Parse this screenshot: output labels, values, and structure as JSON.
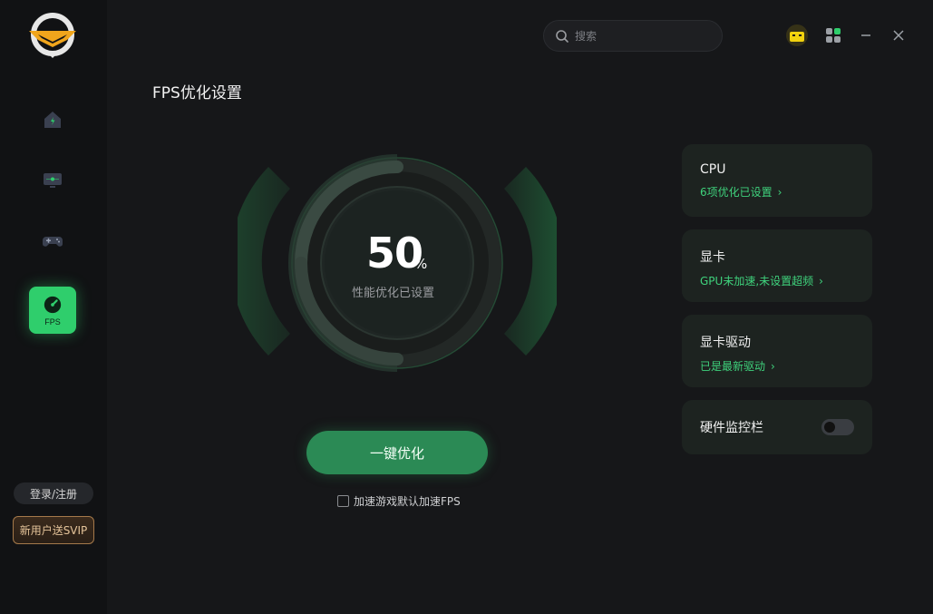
{
  "sidebar": {
    "nav": [
      {
        "name": "home",
        "icon": "home-icon"
      },
      {
        "name": "monitor",
        "icon": "monitor-icon"
      },
      {
        "name": "game",
        "icon": "gamepad-icon"
      },
      {
        "name": "fps",
        "icon": "speedometer-icon",
        "label": "FPS",
        "active": true
      }
    ],
    "login_label": "登录/注册",
    "svip_label": "新用户送SVIP"
  },
  "header": {
    "search_placeholder": "搜索",
    "icons": [
      "gift-icon",
      "apps-grid-icon",
      "minimize-icon",
      "close-icon"
    ]
  },
  "page": {
    "title": "FPS优化设置"
  },
  "gauge": {
    "value": "50",
    "unit": "%",
    "progress": 0.5,
    "subtitle": "性能优化已设置"
  },
  "actions": {
    "optimize_label": "一键优化",
    "checkbox_label": "加速游戏默认加速FPS",
    "checkbox_checked": false
  },
  "cards": [
    {
      "title": "CPU",
      "sub": "6项优化已设置",
      "chevron": "›"
    },
    {
      "title": "显卡",
      "sub": "GPU未加速,未设置超频",
      "chevron": "›"
    },
    {
      "title": "显卡驱动",
      "sub": "已是最新驱动",
      "chevron": "›"
    },
    {
      "title": "硬件监控栏",
      "toggle": false
    }
  ],
  "colors": {
    "accent": "#2fce6c",
    "button": "#2b8a55",
    "link": "#3fd27c",
    "card_bg": "#1d2320",
    "svip_border": "#a5794a"
  }
}
